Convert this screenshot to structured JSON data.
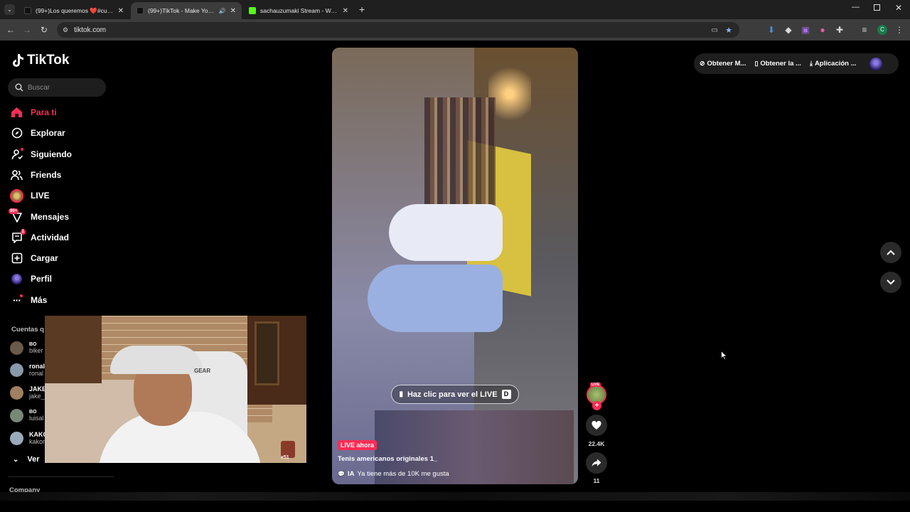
{
  "browser": {
    "tabs": [
      {
        "title": "(99+)Los queremos ❤️#cuidem",
        "active": false,
        "fav_color": "#111111"
      },
      {
        "title": "(99+)TikTok - Make Your Da",
        "active": true,
        "fav_color": "#111111"
      },
      {
        "title": "sachauzumaki Stream - Watch",
        "active": false,
        "fav_color": "#53fc18"
      }
    ],
    "url": "tiktok.com"
  },
  "sidebar": {
    "logo": "TikTok",
    "search_placeholder": "Buscar",
    "nav": [
      {
        "label": "Para ti",
        "icon": "home-icon",
        "active": true
      },
      {
        "label": "Explorar",
        "icon": "compass-icon"
      },
      {
        "label": "Siguiendo",
        "icon": "following-icon"
      },
      {
        "label": "Friends",
        "icon": "friends-icon"
      },
      {
        "label": "LIVE",
        "icon": "live-icon"
      },
      {
        "label": "Mensajes",
        "icon": "messages-icon",
        "badge": "99+"
      },
      {
        "label": "Actividad",
        "icon": "activity-icon",
        "badge": "1"
      },
      {
        "label": "Cargar",
        "icon": "upload-icon"
      },
      {
        "label": "Perfil",
        "icon": "profile-icon"
      },
      {
        "label": "Más",
        "icon": "more-icon"
      }
    ],
    "following_title": "Cuentas q",
    "accounts": [
      {
        "name": "BO",
        "handle": "biker",
        "color": "#6a5a4a"
      },
      {
        "name": "ronal",
        "handle": "ronal",
        "color": "#8899aa"
      },
      {
        "name": "JAKE",
        "handle": "jake_",
        "color": "#a08060"
      },
      {
        "name": "BO",
        "handle": "luisal",
        "color": "#778877"
      },
      {
        "name": "KAKO",
        "handle": "kakor",
        "color": "#99aabb"
      }
    ],
    "see_more": "Ver",
    "company": "Company"
  },
  "video": {
    "live_cta": "Haz clic para ver el LIVE",
    "live_tag": "LIVE ahora",
    "title": "Tenis americanos originales 1_",
    "subtitle_prefix": "IA",
    "subtitle": "Ya tiene más de 10K me gusta"
  },
  "actions": {
    "avatar_live": "LIVE",
    "likes": "22.4K",
    "shares": "11"
  },
  "header": {
    "coins": "Obtener M...",
    "app": "Obtener la ...",
    "desktop": "Aplicación ..."
  },
  "cam": {
    "cap_text": "GEAR",
    "sticker": "x51"
  }
}
